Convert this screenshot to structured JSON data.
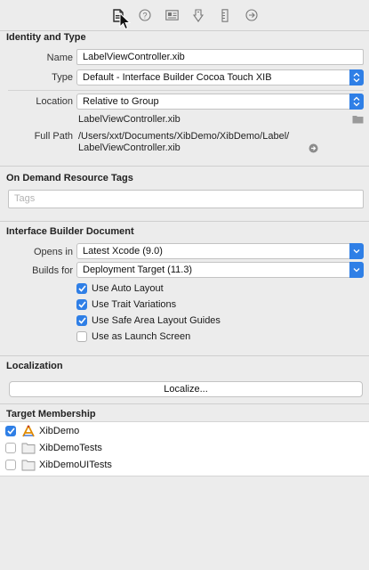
{
  "toolbar": {
    "icons": [
      "file-inspector-icon",
      "quick-help-icon",
      "identity-inspector-icon",
      "attributes-inspector-icon",
      "size-inspector-icon",
      "connections-inspector-icon"
    ]
  },
  "identity": {
    "title": "Identity and Type",
    "name_label": "Name",
    "name_value": "LabelViewController.xib",
    "type_label": "Type",
    "type_value": "Default - Interface Builder Cocoa Touch XIB",
    "location_label": "Location",
    "location_value": "Relative to Group",
    "file_name": "LabelViewController.xib",
    "full_path_label": "Full Path",
    "full_path_line1": "/Users/xxt/Documents/XibDemo/XibDemo/Label/",
    "full_path_line2": "LabelViewController.xib"
  },
  "odr": {
    "title": "On Demand Resource Tags",
    "tags_placeholder": "Tags"
  },
  "ibd": {
    "title": "Interface Builder Document",
    "opens_in_label": "Opens in",
    "opens_in_value": "Latest Xcode (9.0)",
    "builds_for_label": "Builds for",
    "builds_for_value": "Deployment Target (11.3)",
    "options": [
      {
        "label": "Use Auto Layout",
        "checked": true
      },
      {
        "label": "Use Trait Variations",
        "checked": true
      },
      {
        "label": "Use Safe Area Layout Guides",
        "checked": true
      },
      {
        "label": "Use as Launch Screen",
        "checked": false
      }
    ]
  },
  "localization": {
    "title": "Localization",
    "button_label": "Localize..."
  },
  "target_membership": {
    "title": "Target Membership",
    "targets": [
      {
        "name": "XibDemo",
        "checked": true,
        "icon": "app-target-icon"
      },
      {
        "name": "XibDemoTests",
        "checked": false,
        "icon": "test-bundle-icon"
      },
      {
        "name": "XibDemoUITests",
        "checked": false,
        "icon": "test-bundle-icon"
      }
    ]
  },
  "colors": {
    "accent": "#2f7fe6",
    "panel": "#ececec",
    "separator": "#cfcfcf"
  }
}
